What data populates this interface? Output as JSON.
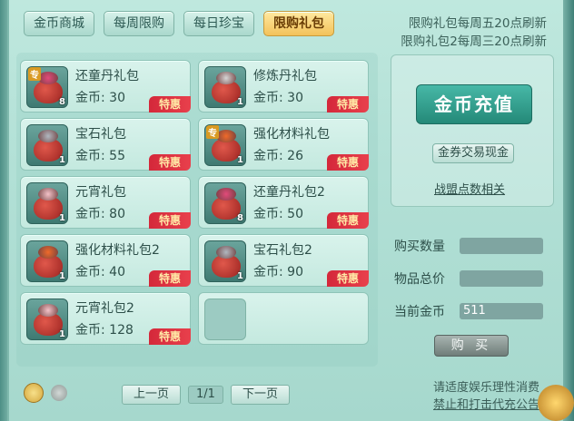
{
  "tabs": [
    {
      "label": "金币商城",
      "active": false
    },
    {
      "label": "每周限购",
      "active": false
    },
    {
      "label": "每日珍宝",
      "active": false
    },
    {
      "label": "限购礼包",
      "active": true
    }
  ],
  "notice": [
    "限购礼包每周五20点刷新",
    "限购礼包2每周三20点刷新"
  ],
  "items": [
    {
      "name": "还童丹礼包",
      "price": "金币: 30",
      "count": "8",
      "tag": "专",
      "badge": "特惠",
      "gem": "#e24a7a"
    },
    {
      "name": "修炼丹礼包",
      "price": "金币: 30",
      "count": "1",
      "tag": "",
      "badge": "特惠",
      "gem": "#d6d6d6"
    },
    {
      "name": "宝石礼包",
      "price": "金币: 55",
      "count": "1",
      "tag": "",
      "badge": "特惠",
      "gem": "#b0b8c0"
    },
    {
      "name": "强化材料礼包",
      "price": "金币: 26",
      "count": "1",
      "tag": "专",
      "badge": "特惠",
      "gem": "#f06a2a"
    },
    {
      "name": "元宵礼包",
      "price": "金币: 80",
      "count": "1",
      "tag": "",
      "badge": "特惠",
      "gem": "#f3c2c8"
    },
    {
      "name": "还童丹礼包2",
      "price": "金币: 50",
      "count": "8",
      "tag": "",
      "badge": "特惠",
      "gem": "#e24a7a"
    },
    {
      "name": "强化材料礼包2",
      "price": "金币: 40",
      "count": "1",
      "tag": "",
      "badge": "特惠",
      "gem": "#f06a2a"
    },
    {
      "name": "宝石礼包2",
      "price": "金币: 90",
      "count": "1",
      "tag": "",
      "badge": "特惠",
      "gem": "#b0b8c0"
    },
    {
      "name": "元宵礼包2",
      "price": "金币: 128",
      "count": "1",
      "tag": "",
      "badge": "特惠",
      "gem": "#f3c2c8"
    }
  ],
  "pager": {
    "prev": "上一页",
    "page": "1/1",
    "next": "下一页"
  },
  "side": {
    "recharge": "金币充值",
    "exchange": "金券交易现金",
    "league": "战盟点数相关"
  },
  "purchase": {
    "qty_label": "购买数量",
    "qty_value": "",
    "total_label": "物品总价",
    "total_value": "",
    "gold_label": "当前金币",
    "gold_value": "511",
    "buy_label": "购 买"
  },
  "footer": [
    "请适度娱乐理性消费",
    "禁止和打击代充公告"
  ],
  "colors": {
    "active_tab": "#f3c25a",
    "badge": "#d4283a",
    "recharge": "#248978"
  }
}
